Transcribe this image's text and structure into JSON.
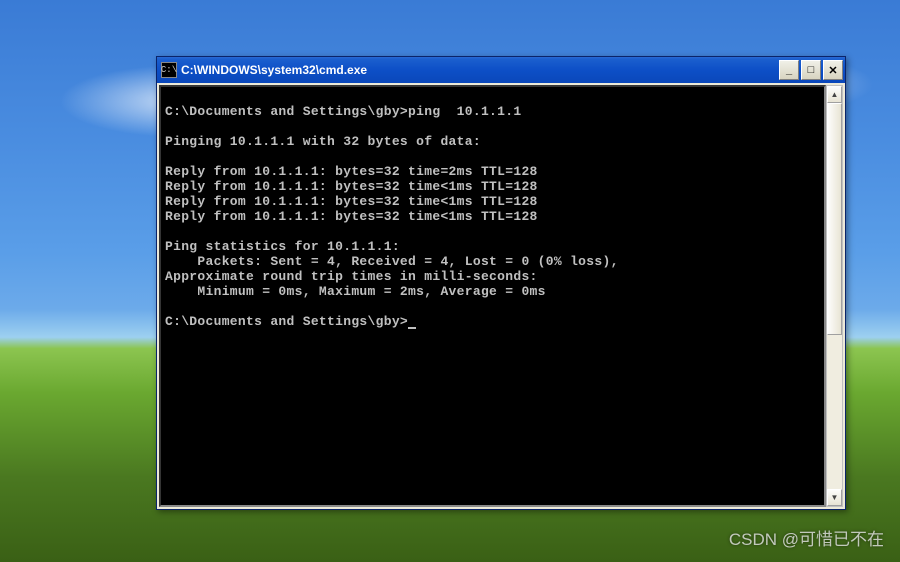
{
  "window": {
    "title": "C:\\WINDOWS\\system32\\cmd.exe",
    "icon_label": "C:\\"
  },
  "console": {
    "lines": [
      "",
      "C:\\Documents and Settings\\gby>ping  10.1.1.1",
      "",
      "Pinging 10.1.1.1 with 32 bytes of data:",
      "",
      "Reply from 10.1.1.1: bytes=32 time=2ms TTL=128",
      "Reply from 10.1.1.1: bytes=32 time<1ms TTL=128",
      "Reply from 10.1.1.1: bytes=32 time<1ms TTL=128",
      "Reply from 10.1.1.1: bytes=32 time<1ms TTL=128",
      "",
      "Ping statistics for 10.1.1.1:",
      "    Packets: Sent = 4, Received = 4, Lost = 0 (0% loss),",
      "Approximate round trip times in milli-seconds:",
      "    Minimum = 0ms, Maximum = 2ms, Average = 0ms",
      "",
      "C:\\Documents and Settings\\gby>"
    ]
  },
  "buttons": {
    "minimize": "_",
    "maximize": "□",
    "close": "✕",
    "scroll_up": "▲",
    "scroll_down": "▼"
  },
  "watermark": "CSDN @可惜已不在"
}
